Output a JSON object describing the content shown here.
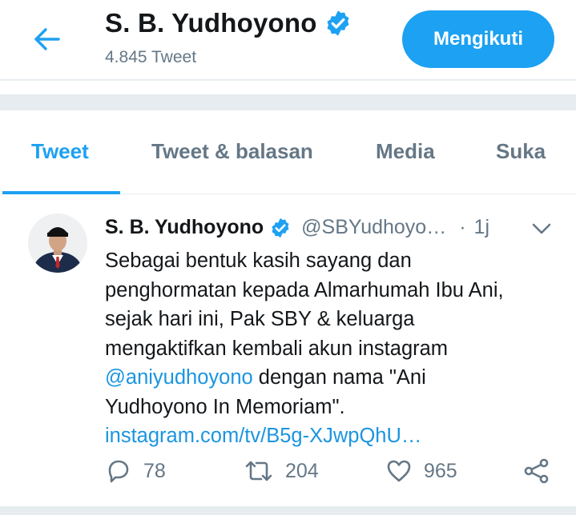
{
  "header": {
    "back_icon": "arrow-left-icon",
    "title": "S. B. Yudhoyono",
    "verified_icon": "verified-badge-icon",
    "tweet_count": "4.845 Tweet",
    "follow_label": "Mengikuti"
  },
  "tabs": [
    {
      "label": "Tweet",
      "active": true
    },
    {
      "label": "Tweet & balasan",
      "active": false
    },
    {
      "label": "Media",
      "active": false
    },
    {
      "label": "Suka",
      "active": false
    }
  ],
  "tweet": {
    "author_name": "S. B. Yudhoyono",
    "handle": "@SBYudhoyo…",
    "separator": "·",
    "time": "1j",
    "body": {
      "line1": "Sebagai bentuk kasih sayang dan",
      "line2": "penghormatan kepada Almarhumah Ibu Ani,",
      "line3": "sejak hari ini, Pak SBY & keluarga",
      "line4": "mengaktifkan kembali akun instagram",
      "mention": "@aniyudhoyono",
      "line5_rest": " dengan nama \"Ani",
      "line6": "Yudhoyono In Memoriam\".",
      "link": "instagram.com/tv/B5g-XJwpQhU…"
    },
    "actions": {
      "reply_count": "78",
      "retweet_count": "204",
      "like_count": "965"
    }
  },
  "colors": {
    "accent": "#1da1f2",
    "link": "#1b95e0",
    "text_secondary": "#657786",
    "divider": "#e6ecf0"
  }
}
